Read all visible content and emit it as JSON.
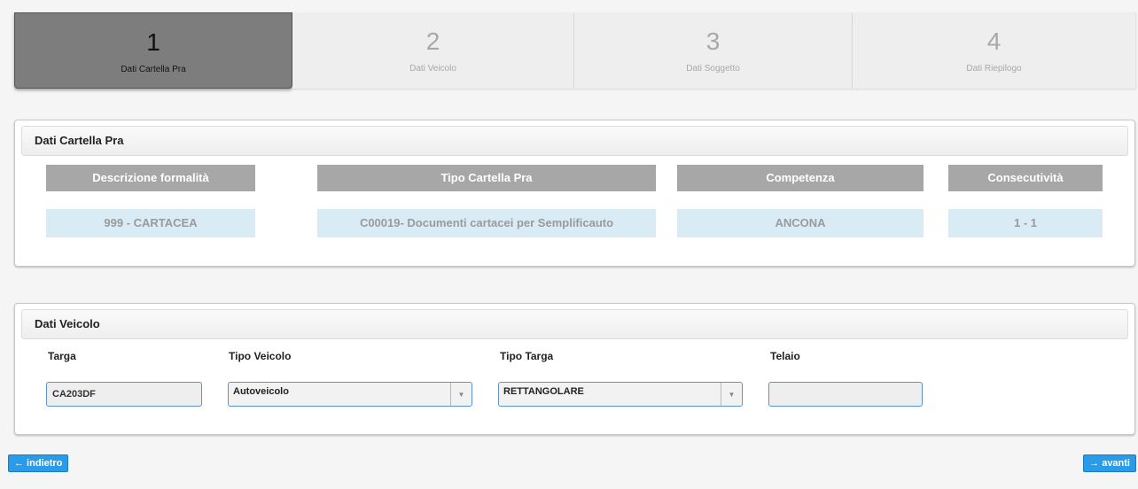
{
  "steps": [
    {
      "number": "1",
      "label": "Dati Cartella Pra"
    },
    {
      "number": "2",
      "label": "Dati Veicolo"
    },
    {
      "number": "3",
      "label": "Dati Soggetto"
    },
    {
      "number": "4",
      "label": "Dati Riepilogo"
    }
  ],
  "cartella": {
    "title": "Dati Cartella Pra",
    "headers": [
      "Descrizione formalità",
      "Tipo Cartella Pra",
      "Competenza",
      "Consecutività"
    ],
    "values": [
      "999 - CARTACEA",
      "C00019- Documenti cartacei per Semplificauto",
      "ANCONA",
      "1 - 1"
    ]
  },
  "veicolo": {
    "title": "Dati Veicolo",
    "targa_label": "Targa",
    "targa_value": "CA203DF",
    "tipo_veicolo_label": "Tipo Veicolo",
    "tipo_veicolo_value": "Autoveicolo",
    "tipo_targa_label": "Tipo Targa",
    "tipo_targa_value": "RETTANGOLARE",
    "telaio_label": "Telaio",
    "telaio_value": ""
  },
  "nav": {
    "back_label": "← indietro",
    "next_label": "→ avanti"
  },
  "colors": {
    "accent": "#2a9be6",
    "active_step": "#7d7d7d",
    "header_gray": "#a7a7a7",
    "value_blue": "#d9ecf5"
  }
}
